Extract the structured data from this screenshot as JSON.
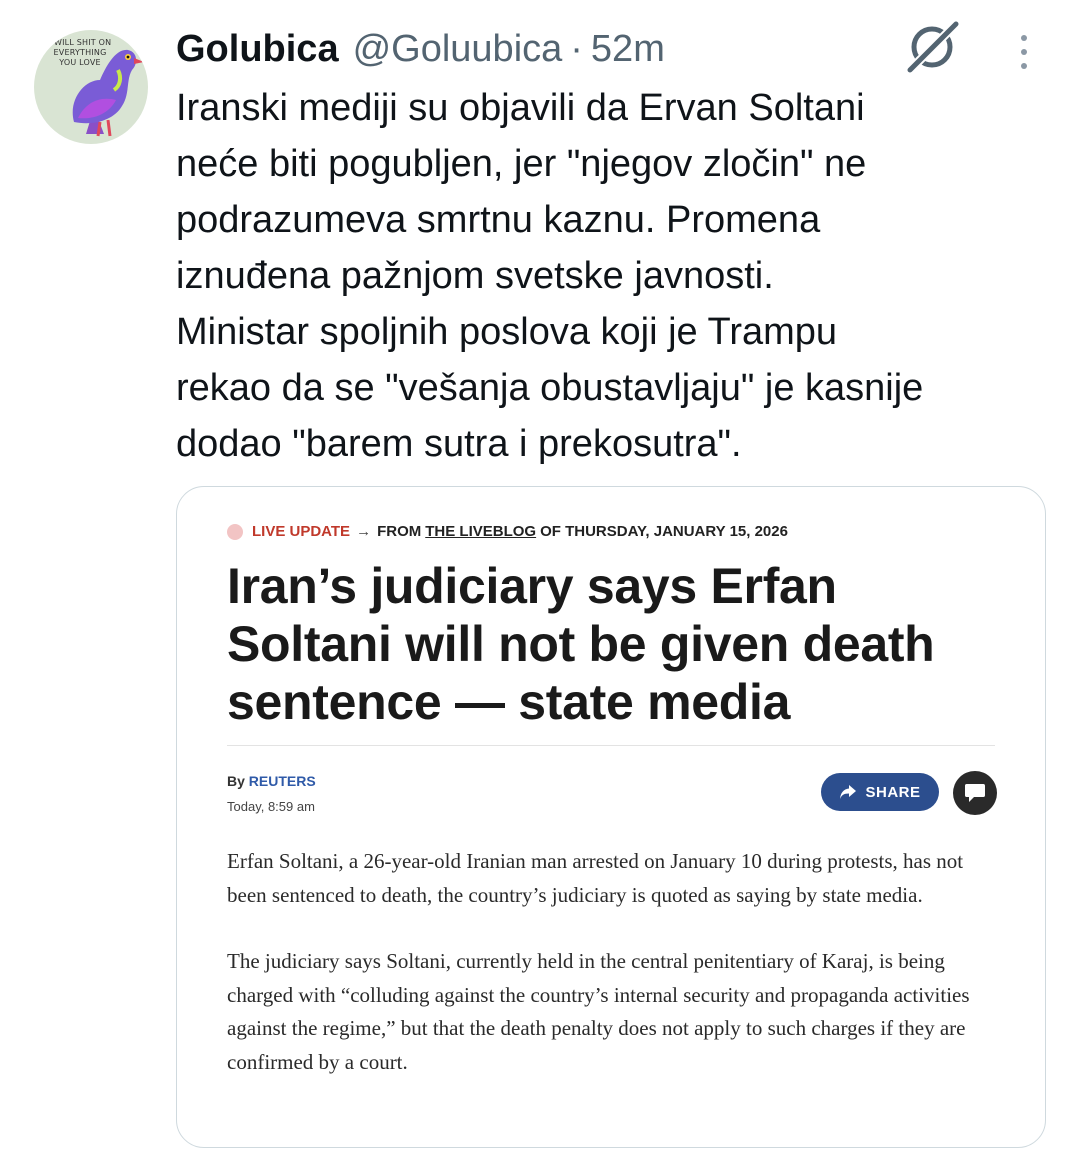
{
  "post": {
    "display_name": "Golubica",
    "handle": "@Goluubica",
    "separator": "·",
    "time": "52m",
    "avatar_text": "I WILL SHIT ON EVERYTHING YOU LOVE",
    "text_lines": [
      "Iranski mediji su objavili da Ervan Soltani",
      "neće biti pogubljen, jer \"njegov zločin\" ne",
      "podrazumeva smrtnu kaznu. Promena",
      "iznuđena pažnjom svetske javnosti.",
      "Ministar spoljnih poslova koji je Trampu",
      "rekao da se \"vešanja obustavljaju\" je kasnije",
      "dodao \"barem sutra i prekosutra\"."
    ]
  },
  "icons": {
    "grok": "grok-icon",
    "more": "more-vertical-icon",
    "share": "share-arrow-icon",
    "comment": "comment-icon"
  },
  "article": {
    "live_label": "LIVE UPDATE",
    "arrow": "→",
    "from_label": "FROM",
    "liveblog_label": "THE LIVEBLOG",
    "date_text": "OF THURSDAY, JANUARY 15, 2026",
    "headline": "Iran’s judiciary says Erfan Soltani will not be given death sentence — state media",
    "by_label": "By",
    "source": "REUTERS",
    "timestamp": "Today, 8:59 am",
    "share_label": "SHARE",
    "paragraphs": [
      "Erfan Soltani, a 26-year-old Iranian man arrested on January 10 during protests, has not been sentenced to death, the country’s judiciary is quoted as saying by state media.",
      "The judiciary says Soltani, currently held in the central penitentiary of Karaj, is being charged with “colluding against the country’s internal security and propaganda activities against the regime,” but that the death penalty does not apply to such charges if they are confirmed by a court."
    ]
  },
  "colors": {
    "text": "#0f1419",
    "secondary": "#536471",
    "live_red": "#c0392b",
    "share_blue": "#2c4e8e",
    "border": "#cfd9de"
  }
}
